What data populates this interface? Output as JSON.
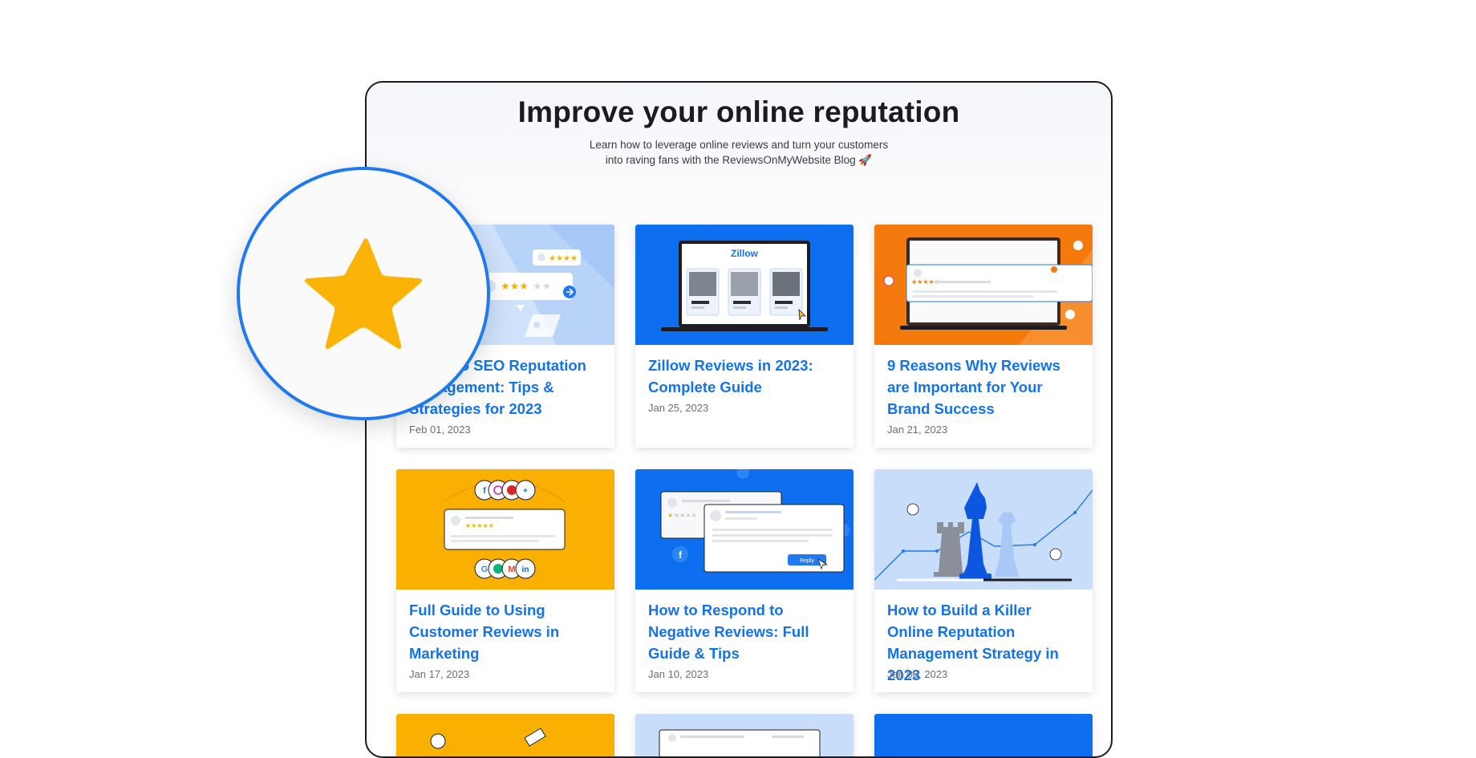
{
  "page": {
    "title": "Improve your online reputation",
    "subtitle_line1": "Learn how to leverage online reviews and turn your customers",
    "subtitle_line2": "into raving fans with the ReviewsOnMyWebsite Blog 🚀"
  },
  "posts": [
    {
      "title": "Guide to SEO Reputation Management: Tips & Strategies for 2023",
      "date": "Feb 01, 2023",
      "thumb_color": "#cfe2fb",
      "thumb_icon": "rating-cards-illustration"
    },
    {
      "title": "Zillow Reviews in 2023: Complete Guide",
      "date": "Jan 25, 2023",
      "thumb_color": "#0d6ff0",
      "thumb_icon": "zillow-laptop-illustration",
      "thumb_text": "Zillow"
    },
    {
      "title": "9 Reasons Why Reviews are Important for Your Brand Success",
      "date": "Jan 21, 2023",
      "thumb_color": "#f57a0e",
      "thumb_icon": "review-laptop-illustration"
    },
    {
      "title": "Full Guide to Using Customer Reviews in Marketing",
      "date": "Jan 17, 2023",
      "thumb_color": "#f9b000",
      "thumb_icon": "social-review-illustration"
    },
    {
      "title": "How to Respond to Negative Reviews: Full Guide & Tips",
      "date": "Jan 10, 2023",
      "thumb_color": "#0d6ff0",
      "thumb_icon": "reply-review-illustration",
      "thumb_text": "Reply"
    },
    {
      "title": "How to Build a Killer Online Reputation Management Strategy in 2023",
      "date": "Jan 06, 2023",
      "thumb_color": "#c7ddfa",
      "thumb_icon": "chess-illustration"
    }
  ],
  "partial_cards": [
    {
      "thumb_color": "#f9b000"
    },
    {
      "thumb_color": "#c7ddfa"
    },
    {
      "thumb_color": "#0d6ff0"
    }
  ],
  "zoom_badge": {
    "icon": "star-icon",
    "star_color": "#fbb307",
    "ring_color": "#1f7af0"
  }
}
